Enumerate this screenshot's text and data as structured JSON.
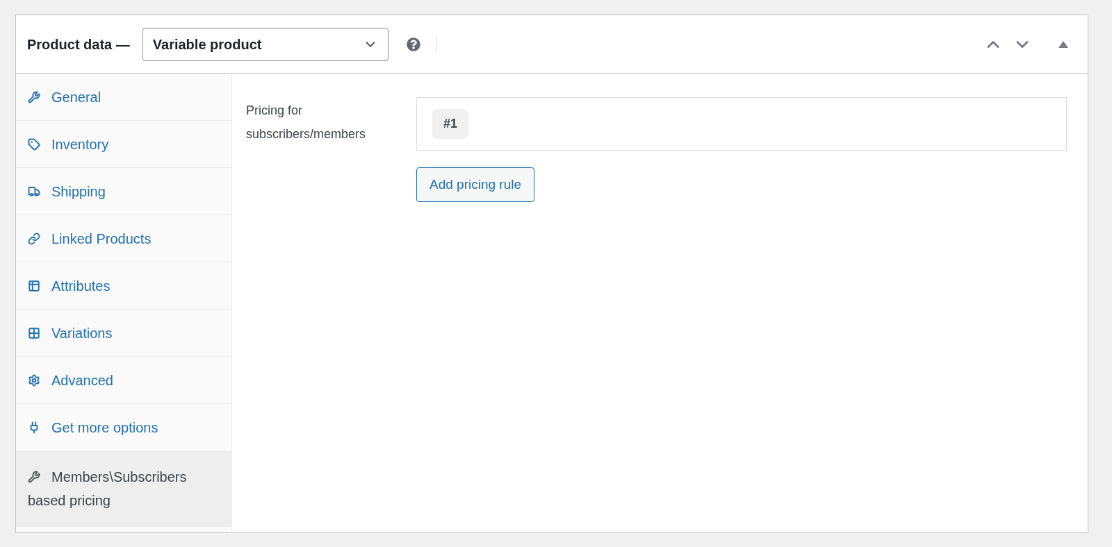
{
  "header": {
    "title": "Product data —",
    "product_type": "Variable product"
  },
  "tabs": [
    {
      "label": "General",
      "selected": false
    },
    {
      "label": "Inventory",
      "selected": false
    },
    {
      "label": "Shipping",
      "selected": false
    },
    {
      "label": "Linked Products",
      "selected": false
    },
    {
      "label": "Attributes",
      "selected": false
    },
    {
      "label": "Variations",
      "selected": false
    },
    {
      "label": "Advanced",
      "selected": false
    },
    {
      "label": "Get more options",
      "selected": false
    },
    {
      "label": "Members\\Subscribers based pricing",
      "selected": true
    }
  ],
  "pricing": {
    "label": "Pricing for subscribers/members",
    "rules": [
      "#1"
    ],
    "add_button": "Add pricing rule"
  }
}
